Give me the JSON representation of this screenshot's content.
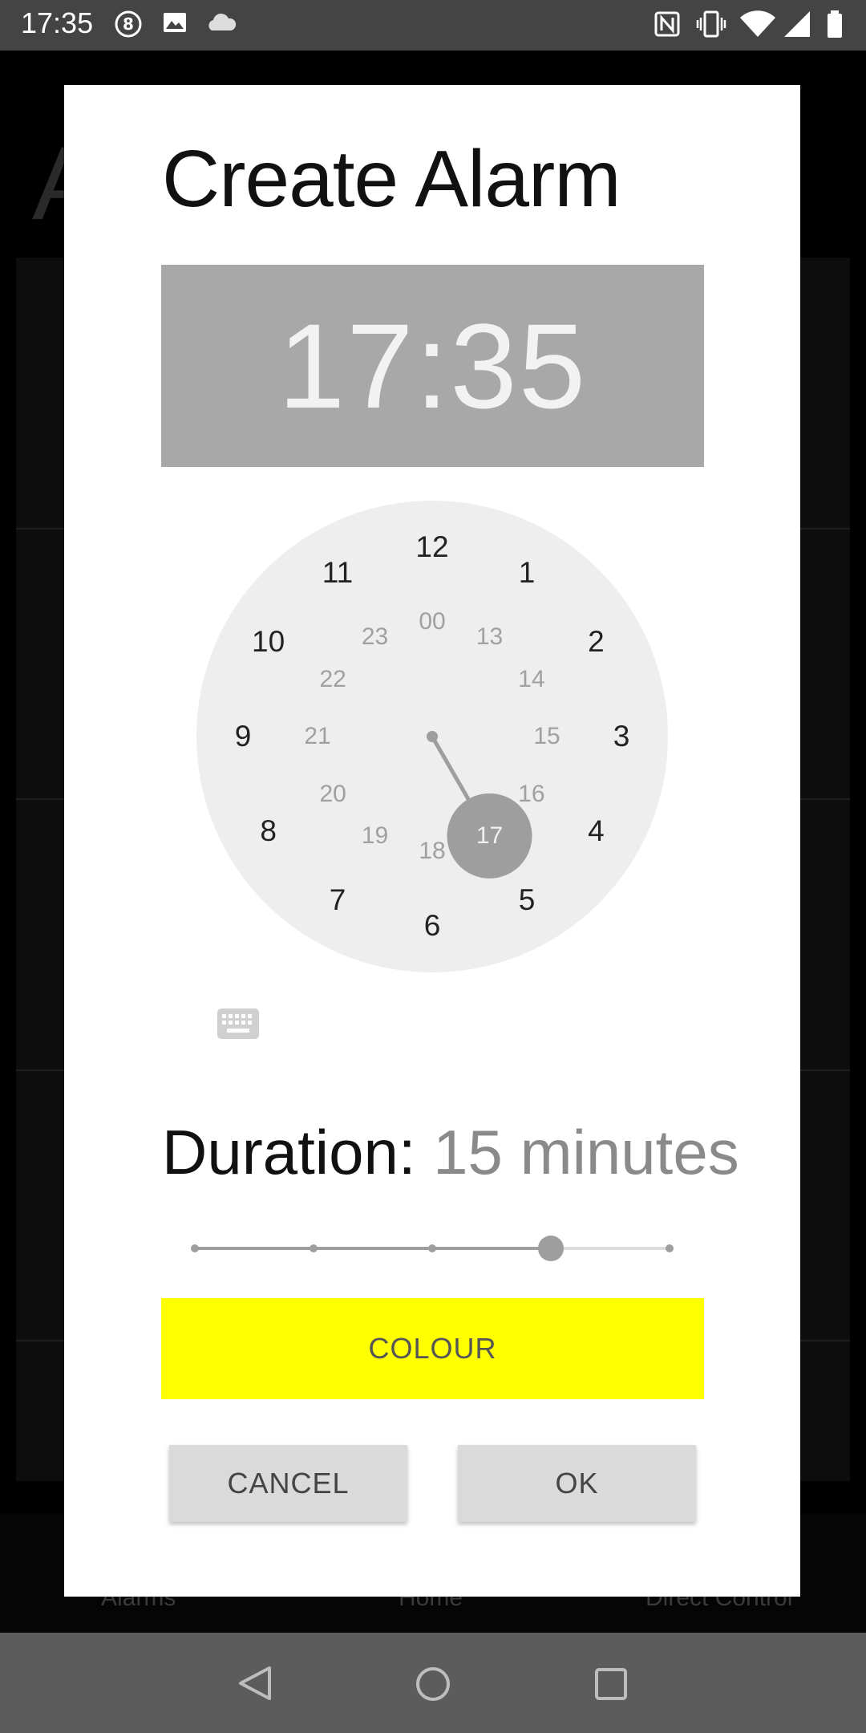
{
  "status_bar": {
    "time": "17:35",
    "left_icons": [
      "circle-8-icon",
      "image-icon",
      "cloud-icon"
    ],
    "right_icons": [
      "nfc-icon",
      "vibrate-icon",
      "wifi-icon",
      "signal-icon",
      "battery-icon"
    ]
  },
  "background": {
    "title_fragment": "A",
    "bottom_nav": [
      "Alarms",
      "Home",
      "Direct Control"
    ]
  },
  "dialog": {
    "title": "Create Alarm",
    "time_display": "17:35",
    "clock": {
      "outer_hours": [
        "12",
        "1",
        "2",
        "3",
        "4",
        "5",
        "6",
        "7",
        "8",
        "9",
        "10",
        "11"
      ],
      "inner_hours": [
        "00",
        "13",
        "14",
        "15",
        "16",
        "17",
        "18",
        "19",
        "20",
        "21",
        "22",
        "23"
      ],
      "selected_hour": "17"
    },
    "keyboard_toggle_icon": "keyboard-icon",
    "duration": {
      "label": "Duration:",
      "value": "15 minutes",
      "slider_steps": 5,
      "slider_position_index": 3
    },
    "colour_button": "COLOUR",
    "cancel_button": "CANCEL",
    "ok_button": "OK"
  },
  "colors": {
    "colour_swatch": "#ffff00",
    "time_display_bg": "#a8a8a8",
    "clock_face": "#eeeeee",
    "accent_grey": "#9e9e9e"
  },
  "navigation_bar": [
    "back-icon",
    "home-icon",
    "recents-icon"
  ]
}
